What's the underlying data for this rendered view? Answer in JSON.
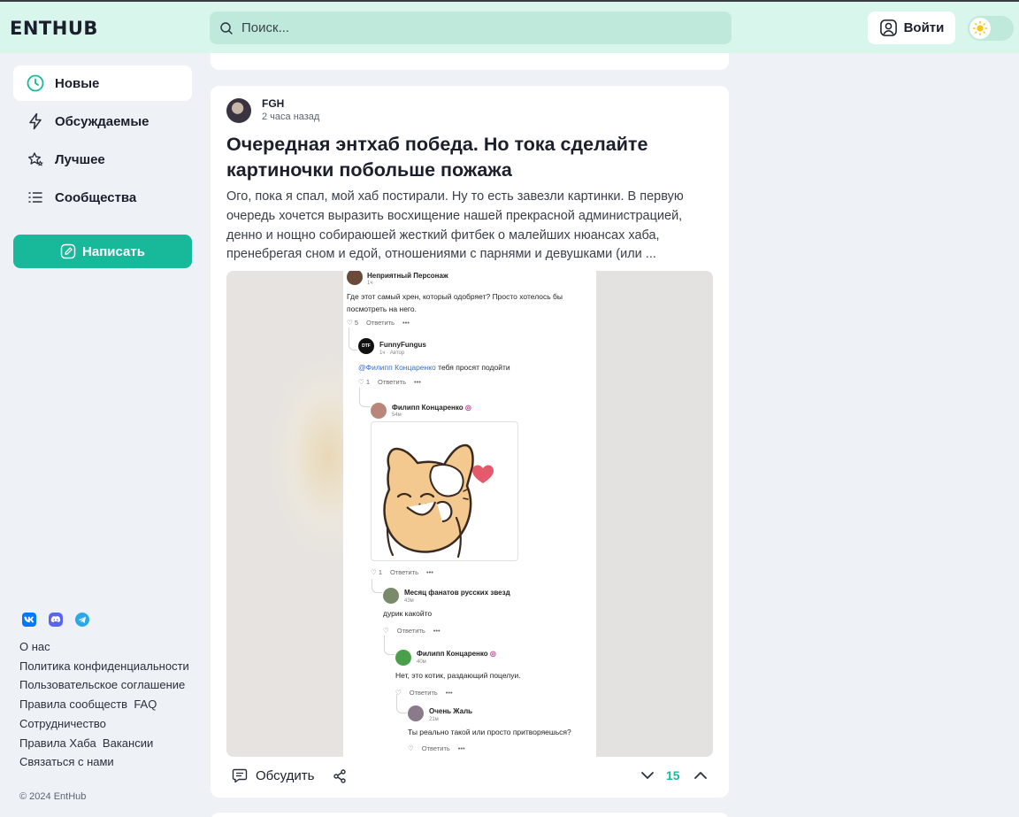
{
  "header": {
    "logo_text": "ENTHUB",
    "search_placeholder": "Поиск...",
    "login_label": "Войти",
    "theme_icon": "sun-icon"
  },
  "sidebar": {
    "items": [
      {
        "label": "Новые",
        "icon": "clock-icon",
        "active": true
      },
      {
        "label": "Обсуждаемые",
        "icon": "lightning-icon",
        "active": false
      },
      {
        "label": "Лучшее",
        "icon": "stars-icon",
        "active": false
      },
      {
        "label": "Сообщества",
        "icon": "list-icon",
        "active": false
      }
    ],
    "write_label": "Написать",
    "social": [
      "vk-icon",
      "discord-icon",
      "telegram-icon"
    ],
    "footer_links": {
      "about": "О нас",
      "privacy": "Политика конфиденциальности",
      "terms": "Пользовательское соглашение",
      "community_rules": "Правила сообществ",
      "faq": "FAQ",
      "cooperation": "Сотрудничество",
      "hub_rules": "Правила Хаба",
      "vacancies": "Вакансии",
      "contact": "Связаться с нами"
    },
    "copyright": "© 2024 EntHub"
  },
  "post": {
    "author": "FGH",
    "time": "2 часа назад",
    "title": "Очередная энтхаб победа. Но тока сделайте картиночки побольше пожажа",
    "excerpt": "Ого, пока я спал, мой хаб постирали. Ну то есть завезли картинки. В первую очередь хочется выразить восхищение нашей прекрасной администрацией, денно и нощно собираюшей жесткий фитбек о малейших нюансах хаба, пренебрегая сном и едой, отношениями с парнями и девушками (или ...",
    "image": {
      "comments": [
        {
          "name": "Неприятный Персонаж",
          "time": "1ч",
          "text": "Где этот самый хрен, который одобряет? Просто хотелось бы посмотреть на него.",
          "likes": "5",
          "reply": "Ответить"
        },
        {
          "name": "FunnyFungus",
          "avatar_text": "DTF",
          "time": "1ч · Автор",
          "mention": "@Филипп Концаренко",
          "text": "тебя просят подойти",
          "likes": "1",
          "reply": "Ответить"
        },
        {
          "name": "Филипп Концаренко",
          "time": "54м",
          "likes": "1",
          "reply": "Ответить"
        },
        {
          "name": "Месяц фанатов русских звезд",
          "time": "43м",
          "text": "дурик какойто",
          "reply": "Ответить"
        },
        {
          "name": "Филипп Концаренко",
          "time": "40м",
          "text": "Нет, это котик, раздающий поцелуи.",
          "reply": "Ответить"
        },
        {
          "name": "Очень Жаль",
          "time": "21м",
          "text": "Ты реально такой или просто притворяешься?",
          "reply": "Ответить"
        }
      ]
    },
    "discuss_label": "Обсудить",
    "rating": "15"
  },
  "colors": {
    "accent": "#18b89b",
    "header_bg": "#d8f6ec",
    "page_bg": "#eef1f6"
  }
}
